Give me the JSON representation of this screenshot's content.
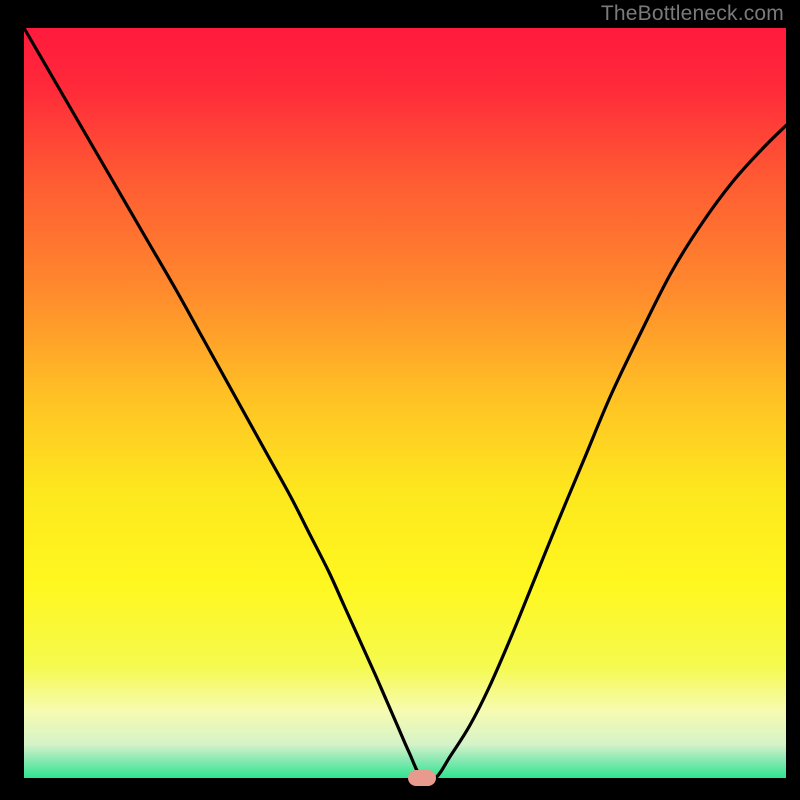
{
  "attribution": "TheBottleneck.com",
  "plot": {
    "margin_left": 24,
    "margin_right": 14,
    "margin_top": 28,
    "margin_bottom": 22,
    "inner_width": 762,
    "inner_height": 750
  },
  "gradient_stops": [
    {
      "offset": 0.0,
      "color": "#ff1a3d"
    },
    {
      "offset": 0.08,
      "color": "#ff2a3a"
    },
    {
      "offset": 0.2,
      "color": "#ff5a33"
    },
    {
      "offset": 0.35,
      "color": "#ff8a2d"
    },
    {
      "offset": 0.5,
      "color": "#ffc424"
    },
    {
      "offset": 0.62,
      "color": "#fde81e"
    },
    {
      "offset": 0.74,
      "color": "#fff71f"
    },
    {
      "offset": 0.85,
      "color": "#f5fa4d"
    },
    {
      "offset": 0.91,
      "color": "#f7fbb0"
    },
    {
      "offset": 0.955,
      "color": "#d5f3c8"
    },
    {
      "offset": 0.975,
      "color": "#8ce9b4"
    },
    {
      "offset": 1.0,
      "color": "#2fe58e"
    }
  ],
  "chart_data": {
    "type": "line",
    "title": "",
    "xlabel": "",
    "ylabel": "",
    "xlim": [
      0,
      100
    ],
    "ylim": [
      0,
      100
    ],
    "grid": false,
    "legend": false,
    "marker": {
      "x": 52.2,
      "y": 0
    },
    "series": [
      {
        "name": "curve",
        "x": [
          0,
          4,
          8,
          12,
          16,
          20,
          23,
          26,
          29,
          32,
          35,
          37.5,
          40,
          42,
          44,
          46,
          47.5,
          49,
          50.5,
          52.2,
          54,
          56,
          58.5,
          61,
          64,
          67,
          70,
          73.5,
          77,
          81,
          85,
          89,
          93,
          97,
          100
        ],
        "y": [
          100,
          93,
          86,
          79,
          72,
          65,
          59.5,
          54,
          48.5,
          43,
          37.5,
          32.5,
          27.5,
          23,
          18.5,
          14,
          10.5,
          7,
          3.5,
          0,
          0,
          3,
          7,
          12,
          19,
          26.5,
          34,
          42.5,
          51,
          59.5,
          67.5,
          74,
          79.5,
          84,
          87
        ]
      }
    ]
  }
}
